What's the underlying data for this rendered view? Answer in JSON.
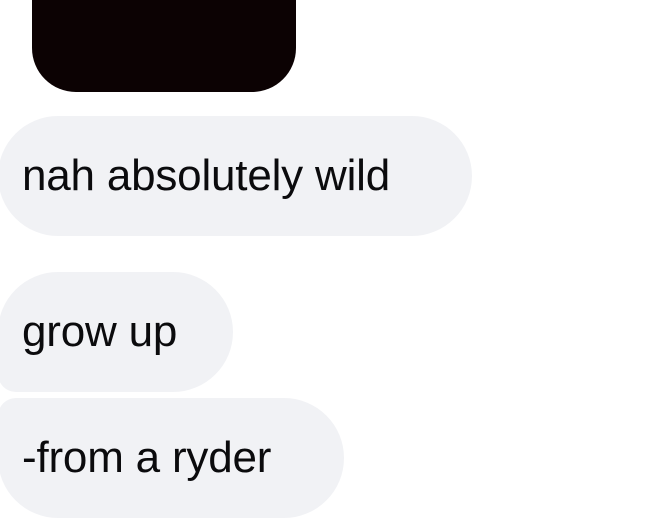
{
  "thread": {
    "attachment": {
      "type": "image",
      "color": "#0c0203"
    },
    "messages": [
      {
        "text": "nah absolutely wild"
      },
      {
        "text": "grow up"
      },
      {
        "text": "-from a ryder"
      }
    ],
    "bubble_color": "#f1f2f5",
    "text_color": "#0b0b0d"
  }
}
